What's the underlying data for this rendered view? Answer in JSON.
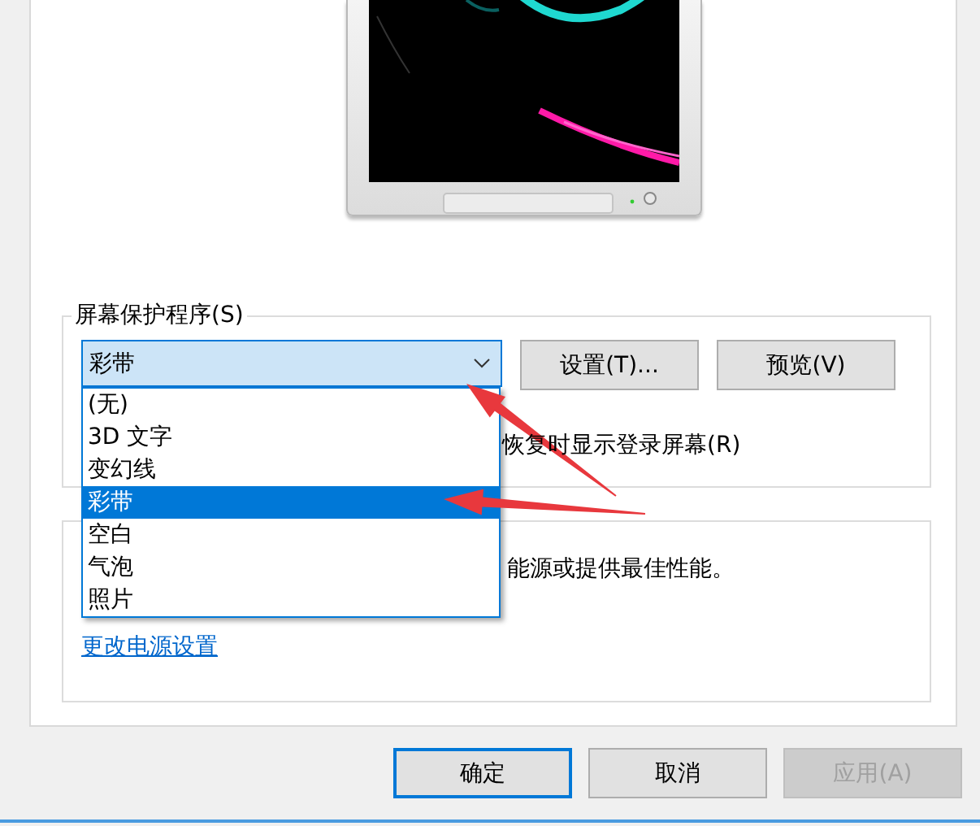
{
  "screensaver_group": {
    "title": "屏幕保护程序(S)",
    "combo": {
      "value": "彩带",
      "expanded": true
    },
    "buttons": [
      {
        "label": "设置(T)..."
      },
      {
        "label": "预览(V)"
      }
    ],
    "checkbox_label": "恢复时显示登录屏幕(R)"
  },
  "dropdown": [
    {
      "label": "(无)",
      "selected": false
    },
    {
      "label": "3D 文字",
      "selected": false
    },
    {
      "label": "变幻线",
      "selected": false
    },
    {
      "label": "彩带",
      "selected": true
    },
    {
      "label": "空白",
      "selected": false
    },
    {
      "label": "气泡",
      "selected": false
    },
    {
      "label": "照片",
      "selected": false
    }
  ],
  "power_group": {
    "text": "能源或提供最佳性能。",
    "link": "更改电源设置"
  },
  "buttons": [
    {
      "label": "确定",
      "default": true,
      "disabled": false
    },
    {
      "label": "取消",
      "default": false,
      "disabled": false
    },
    {
      "label": "应用(A)",
      "default": false,
      "disabled": true
    }
  ],
  "arrows": [
    {
      "kind": "arrow"
    },
    {
      "kind": "arrow"
    }
  ]
}
